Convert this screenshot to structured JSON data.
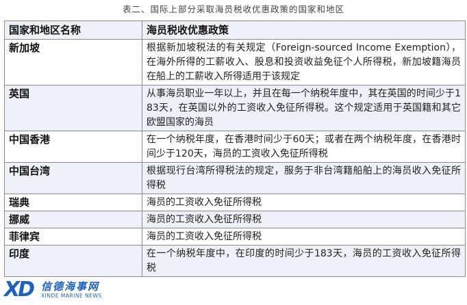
{
  "caption": "表二、国际上部分采取海员税收优惠政策的国家和地区",
  "headers": {
    "region": "国家和地区名称",
    "policy": "海员税收优惠政策"
  },
  "rows": [
    {
      "region": "新加坡",
      "policy": "根据新加坡税法的有关规定（Foreign-sourced Income Exemption），在海外所得的工薪收入、股息和投资收益免征个人所得税，新加坡籍海员在船上的工薪收入所得适用于该规定"
    },
    {
      "region": "英国",
      "policy": "从事海员职业一年以上，并且在每一个纳税年度中，其在英国的时间少于183天，在英国以外的工资收入免征所得税。这个规定适用于英国籍和其它欧盟国家的海员"
    },
    {
      "region": "中国香港",
      "policy": "在一个纳税年度，在香港时间少于60天；或者在两个纳税年度，在香港时间少于120天，海员的工资收入免征所得税"
    },
    {
      "region": "中国台湾",
      "policy": "根据现行台湾所得税法的规定，服务于非台湾籍船舶上的海员收入免征所得税"
    },
    {
      "region": "瑞典",
      "policy": "海员的工资收入免征所得税"
    },
    {
      "region": "挪威",
      "policy": "海员的工资收入免征所得税"
    },
    {
      "region": "菲律宾",
      "policy": "海员的工资收入免征所得税"
    },
    {
      "region": "印度",
      "policy": "在一个纳税年度中，在印度的时间少于183天，海员的工资收入免征所得税"
    }
  ],
  "watermark": {
    "mark": "XD",
    "name_cn": "信德海事网",
    "name_en": "XINDE MARINE NEWS",
    "color": "#1f63b8"
  }
}
